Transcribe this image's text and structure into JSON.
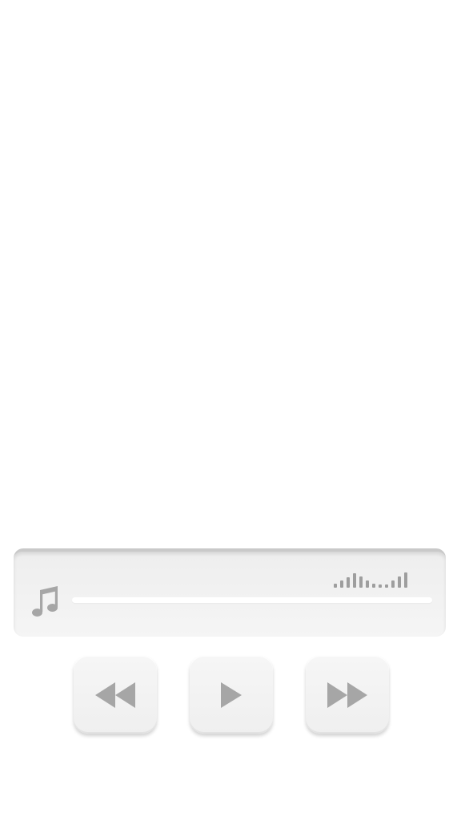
{
  "colors": {
    "background": "#ffffff",
    "panel": "#efefef",
    "panel_border": "#c9c9c9",
    "icon": "#a6a6a6",
    "equalizer": "#9e9e9e",
    "track": "#ffffff"
  },
  "player": {
    "track_icon": "music-note-icon",
    "equalizer_icon": "equalizer-bars-icon",
    "progress": 0,
    "controls": [
      {
        "name": "rewind",
        "icon": "rewind-icon"
      },
      {
        "name": "play",
        "icon": "play-icon"
      },
      {
        "name": "fast-forward",
        "icon": "fast-forward-icon"
      }
    ]
  }
}
